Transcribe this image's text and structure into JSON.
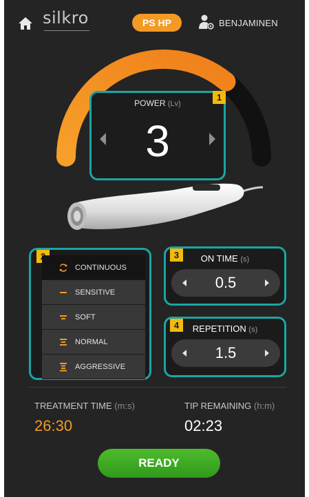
{
  "header": {
    "brand": "silkro",
    "mode_button": "PS HP",
    "user_name": "BENJAMINEN"
  },
  "power": {
    "badge": "1",
    "label": "POWER",
    "unit": "(Lv)",
    "value": "3",
    "gauge_fill_fraction": 0.72
  },
  "modes": {
    "badge": "2",
    "items": [
      {
        "label": "CONTINUOUS",
        "icon": "refresh-icon",
        "selected": true
      },
      {
        "label": "SENSITIVE",
        "icon": "one-bar-icon",
        "selected": false
      },
      {
        "label": "SOFT",
        "icon": "two-bars-icon",
        "selected": false
      },
      {
        "label": "NORMAL",
        "icon": "three-bars-icon",
        "selected": false
      },
      {
        "label": "AGGRESSIVE",
        "icon": "four-bars-icon",
        "selected": false
      }
    ]
  },
  "on_time": {
    "badge": "3",
    "label": "ON TIME",
    "unit": "(s)",
    "value": "0.5"
  },
  "repetition": {
    "badge": "4",
    "label": "REPETITION",
    "unit": "(s)",
    "value": "1.5"
  },
  "treatment_time": {
    "label": "TREATMENT TIME",
    "unit": "(m:s)",
    "value": "26:30"
  },
  "tip_remaining": {
    "label": "TIP REMAINING",
    "unit": "(h:m)",
    "value": "02:23"
  },
  "ready_button": "READY",
  "colors": {
    "accent_orange": "#f39a25",
    "frame_teal": "#1aa6a4",
    "badge_yellow": "#f2ba0c",
    "ready_green": "#3aaa22",
    "background": "#242424"
  }
}
